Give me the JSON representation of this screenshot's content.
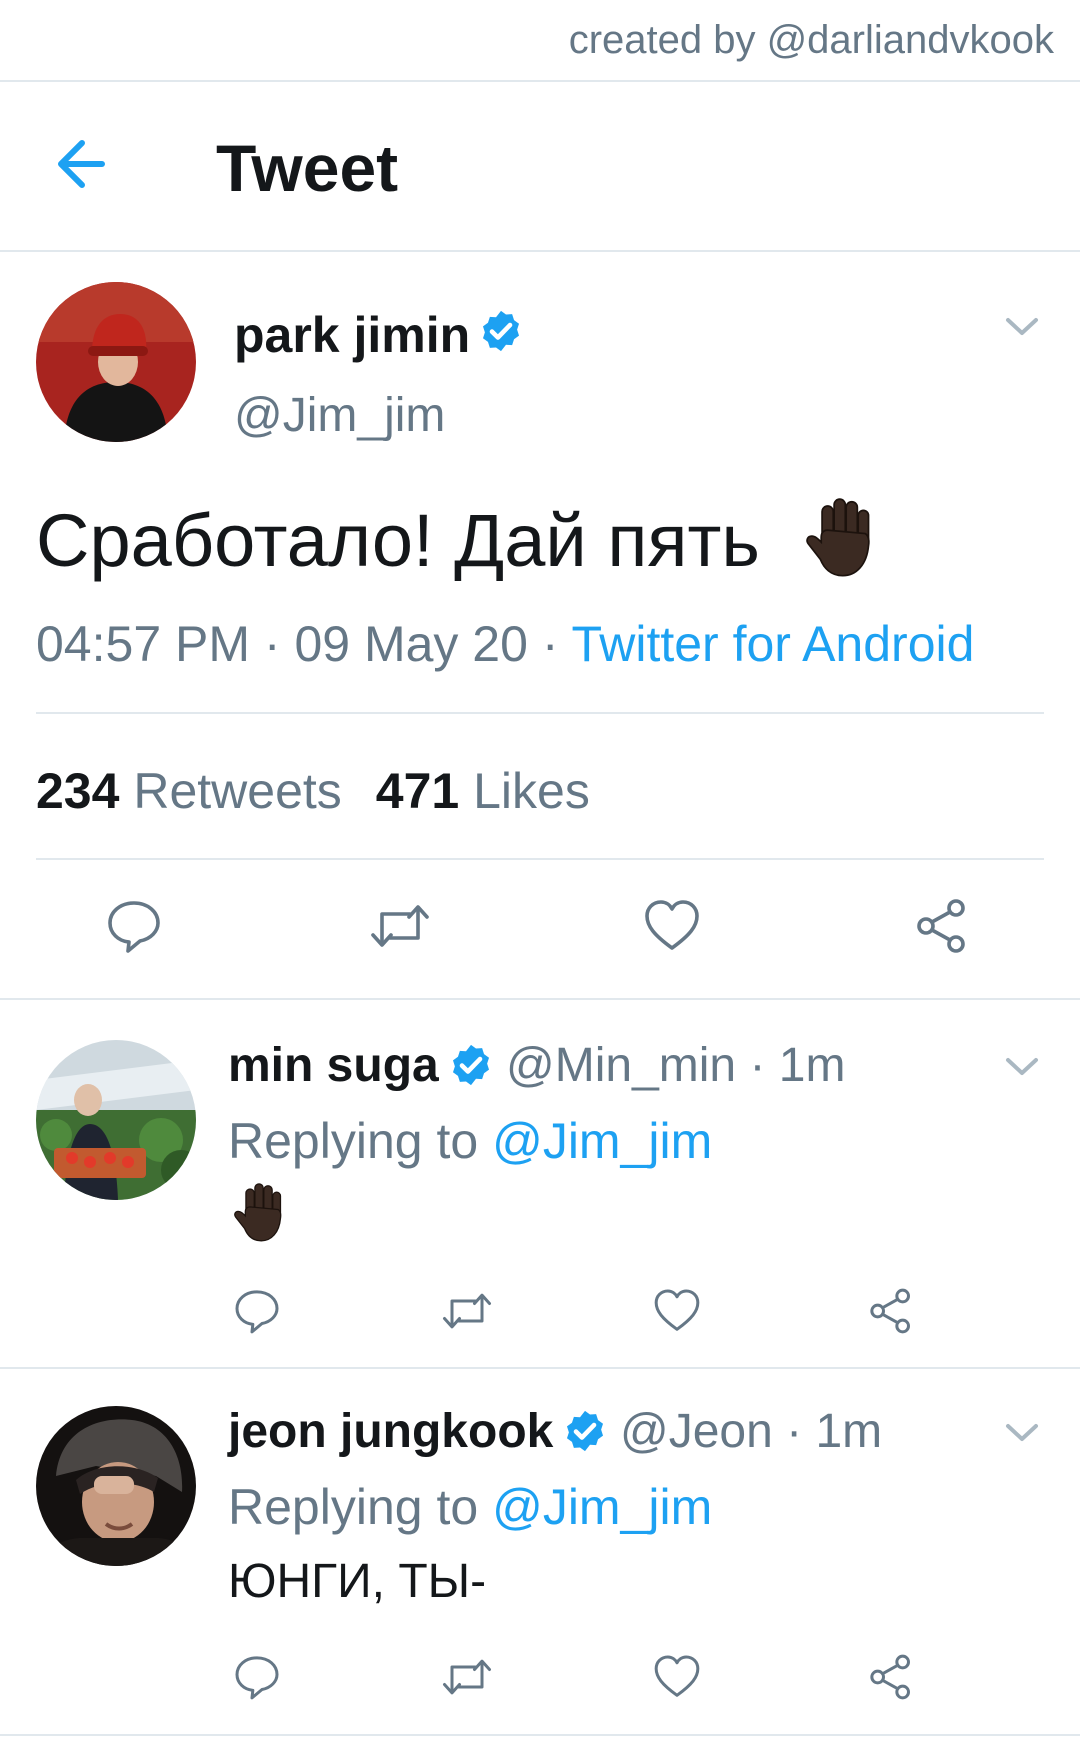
{
  "credit": "created by @darliandvkook",
  "header": {
    "title": "Tweet"
  },
  "main_tweet": {
    "name": "park jimin",
    "handle": "@Jim_jim",
    "text": "Сработало! Дай пять",
    "time": "04:57 PM",
    "date": "09 May 20",
    "source": "Twitter for Android",
    "retweets_count": "234",
    "retweets_label": "Retweets",
    "likes_count": "471",
    "likes_label": "Likes"
  },
  "replies": [
    {
      "name": "min suga",
      "handle": "@Min_min",
      "time": "1m",
      "replying_label": "Replying to",
      "replying_to": "@Jim_jim",
      "text": ""
    },
    {
      "name": "jeon jungkook",
      "handle": "@Jeon",
      "time": "1m",
      "replying_label": "Replying to",
      "replying_to": "@Jim_jim",
      "text": "ЮНГИ, ТЫ-"
    }
  ],
  "icons": {
    "back": "arrow-left-icon",
    "verified": "verified-badge-icon",
    "menu": "chevron-down-icon",
    "emoji": "raised-hand-dark-skin-emoji",
    "actions": [
      "reply-icon",
      "retweet-icon",
      "like-icon",
      "share-icon"
    ]
  },
  "colors": {
    "accent": "#1da1f2",
    "secondary_text": "#657786",
    "primary_text": "#14171a",
    "divider": "#e1e8ed",
    "skin": "#3b2a22"
  }
}
